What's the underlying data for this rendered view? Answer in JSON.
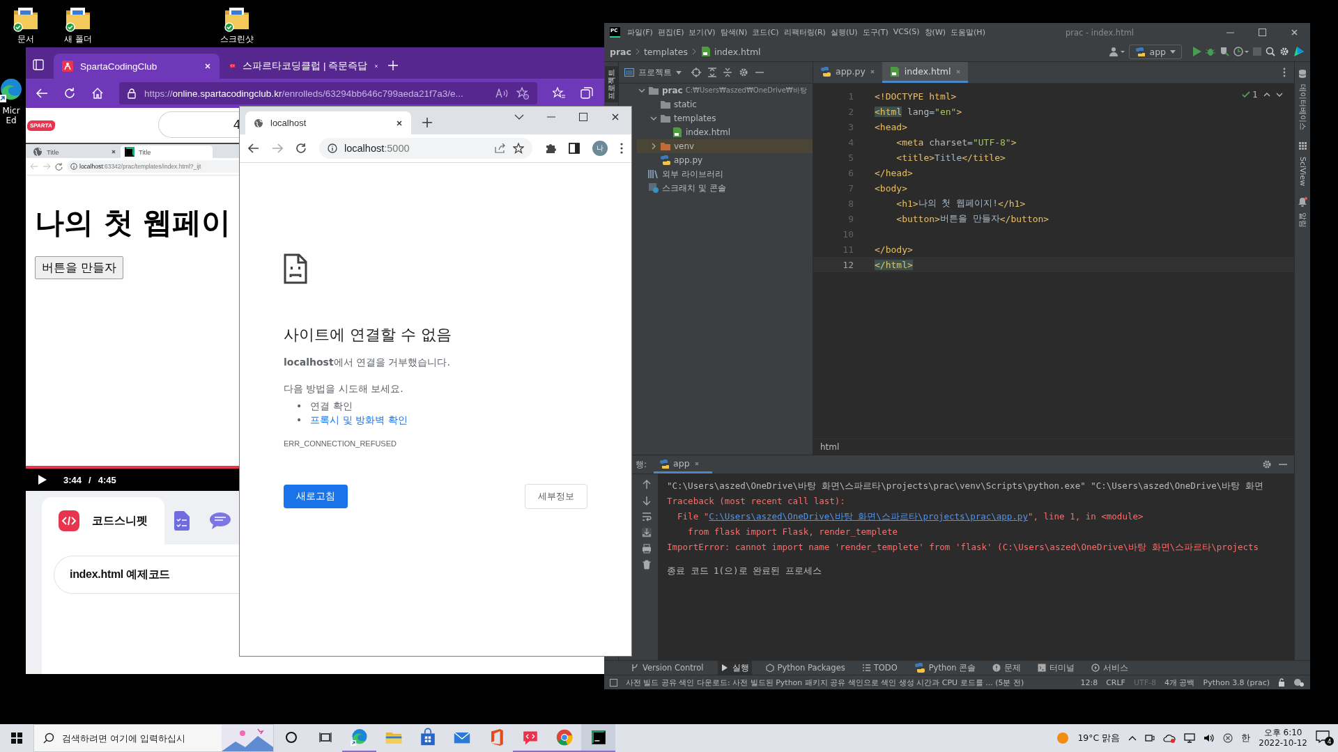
{
  "desktop_icons": [
    {
      "kind": "folder",
      "label": "문서"
    },
    {
      "kind": "folder",
      "label": "새 폴더"
    },
    {
      "kind": "folder",
      "label": "스크린샷"
    },
    {
      "kind": "edge",
      "label": "Micr Ed"
    }
  ],
  "edge": {
    "tabs": [
      {
        "kind": "sparta",
        "title": "SpartaCodingClub",
        "selected": true
      },
      {
        "kind": "qna",
        "title": "스파르타코딩클럽 | 즉문즉답",
        "selected": false
      }
    ],
    "url_scheme": "https://",
    "url_host": "online.spartacodingclub.kr",
    "url_path": "/enrolleds/63294bb646c799aeda21f7a3/e...",
    "logo": "SPARTA",
    "search_pill": "4",
    "video": {
      "tabs": [
        {
          "kind": "globe",
          "title": "Title",
          "selected": false
        },
        {
          "kind": "pycharm",
          "title": "Title",
          "selected": true
        }
      ],
      "url_host": "localhost",
      "url_path": ":63342/prac/templates/index.html?_ijt",
      "heading": "나의 첫 웹페이",
      "button": "버튼을 만들자",
      "current_time": "3:44",
      "time_separator": "/",
      "duration": "4:45"
    },
    "panel_tabs": [
      {
        "kind": "snippet",
        "label": "코드스니펫",
        "selected": true
      },
      {
        "kind": "checklist",
        "selected": false
      },
      {
        "kind": "chat",
        "selected": false
      }
    ],
    "snippet": "index.html 예제코드"
  },
  "chrome": {
    "tab_title": "localhost",
    "url_host": "localhost",
    "url_port": ":5000",
    "avatar": "나",
    "error": {
      "title": "사이트에 연결할 수 없음",
      "message": "**localhost**에서 연결을 거부했습니다.",
      "suggest": "다음 방법을 시도해 보세요.",
      "items": [
        {
          "kind": "text",
          "marker": "•",
          "text": "연결 확인"
        },
        {
          "kind": "link",
          "marker": "•",
          "text": "프록시 및 방화벽 확인"
        }
      ],
      "code": "ERR_CONNECTION_REFUSED",
      "reload": "새로고침",
      "details": "세부정보"
    }
  },
  "pycharm": {
    "logo": "PC",
    "menu": [
      "파일(F)",
      "편집(E)",
      "보기(V)",
      "탐색(N)",
      "코드(C)",
      "리팩터링(R)",
      "실행(U)",
      "도구(T)",
      "VCS(S)",
      "창(W)",
      "도움말(H)"
    ],
    "title": "prac - index.html",
    "breadcrumb": [
      {
        "kind": "project",
        "text": "prac"
      },
      {
        "kind": "folder",
        "text": "templates"
      },
      {
        "kind": "html",
        "text": "index.html"
      }
    ],
    "run_config": "app",
    "left_tools": [
      {
        "label": "프로젝트",
        "selected": true
      }
    ],
    "project_title": "프로젝트",
    "tree": [
      {
        "kind": "project",
        "name": "prac",
        "path": "C:₩Users₩aszed₩OneDrive₩바탕",
        "expanded": true,
        "selected": false,
        "children": [
          {
            "kind": "folder",
            "name": "static",
            "selected": false
          },
          {
            "kind": "folder",
            "name": "templates",
            "expanded": true,
            "selected": false,
            "children": [
              {
                "kind": "html",
                "name": "index.html",
                "selected": false
              }
            ]
          },
          {
            "kind": "excluded",
            "name": "venv",
            "expanded": false,
            "selected": true
          },
          {
            "kind": "python",
            "name": "app.py",
            "selected": false
          }
        ]
      },
      {
        "kind": "library",
        "name": "외부 라이브러리",
        "selected": false
      },
      {
        "kind": "scratch",
        "name": "스크래치 및 콘솔",
        "selected": false
      }
    ],
    "editor_tabs": [
      {
        "kind": "python",
        "name": "app.py",
        "selected": false
      },
      {
        "kind": "html",
        "name": "index.html",
        "selected": true
      }
    ],
    "inspections": "1",
    "code": [
      {
        "number": "1",
        "current": false,
        "tokens": [
          {
            "kind": "tag",
            "text": "<!DOCTYPE html>"
          }
        ]
      },
      {
        "number": "2",
        "current": false,
        "tokens": [
          {
            "kind": "tag",
            "text": "<html",
            "matched": true
          },
          {
            "kind": "attr",
            "text": " lang"
          },
          {
            "kind": "text",
            "text": "="
          },
          {
            "kind": "string",
            "text": "\"en\""
          },
          {
            "kind": "tag",
            "text": ">"
          }
        ]
      },
      {
        "number": "3",
        "current": false,
        "tokens": [
          {
            "kind": "tag",
            "text": "<head>"
          }
        ]
      },
      {
        "number": "4",
        "current": false,
        "tokens": [
          {
            "kind": "tag",
            "text": "    <meta"
          },
          {
            "kind": "attr",
            "text": " charset"
          },
          {
            "kind": "text",
            "text": "="
          },
          {
            "kind": "string",
            "text": "\"UTF-8\""
          },
          {
            "kind": "tag",
            "text": ">"
          }
        ]
      },
      {
        "number": "5",
        "current": false,
        "tokens": [
          {
            "kind": "tag",
            "text": "    <title>"
          },
          {
            "kind": "text",
            "text": "Title"
          },
          {
            "kind": "tag",
            "text": "</title>"
          }
        ]
      },
      {
        "number": "6",
        "current": false,
        "tokens": [
          {
            "kind": "tag",
            "text": "</head>"
          }
        ]
      },
      {
        "number": "7",
        "current": false,
        "tokens": [
          {
            "kind": "tag",
            "text": "<body>"
          }
        ]
      },
      {
        "number": "8",
        "current": false,
        "tokens": [
          {
            "kind": "tag",
            "text": "    <h1>"
          },
          {
            "kind": "text",
            "text": "나의 첫 웹페이지!"
          },
          {
            "kind": "tag",
            "text": "</h1>"
          }
        ]
      },
      {
        "number": "9",
        "current": false,
        "tokens": [
          {
            "kind": "tag",
            "text": "    <button>"
          },
          {
            "kind": "text",
            "text": "버튼을 만들자"
          },
          {
            "kind": "tag",
            "text": "</button>"
          }
        ]
      },
      {
        "number": "10",
        "current": false
      },
      {
        "number": "11",
        "current": false,
        "tokens": [
          {
            "kind": "tag",
            "text": "</body>"
          }
        ]
      },
      {
        "number": "12",
        "current": true,
        "tokens": [
          {
            "kind": "tag",
            "text": "</html>",
            "matched": true
          }
        ]
      }
    ],
    "editor_breadcrumb": "html",
    "right_tools": [
      {
        "kind": "database",
        "label": "데이터베이스"
      },
      {
        "kind": "sciview",
        "label": "SciView"
      },
      {
        "kind": "notifications",
        "label": "알림"
      }
    ],
    "run": {
      "label": "행:",
      "tab": "app",
      "lines": [
        {
          "segments": [
            {
              "kind": "command",
              "text": "\"C:\\Users\\aszed\\OneDrive\\바탕 화면\\스파르타\\projects\\prac\\venv\\Scripts\\python.exe\" \"C:\\Users\\aszed\\OneDrive\\바탕 화면"
            }
          ]
        },
        {
          "segments": [
            {
              "kind": "error",
              "text": "Traceback (most recent call last):"
            }
          ]
        },
        {
          "segments": [
            {
              "kind": "error",
              "text": "  File \""
            },
            {
              "kind": "link",
              "text": "C:\\Users\\aszed\\OneDrive\\바탕 화면\\스파르타\\projects\\prac\\app.py"
            },
            {
              "kind": "error",
              "text": "\", line 1, in <module>"
            }
          ]
        },
        {
          "segments": [
            {
              "kind": "error",
              "text": "    from flask import Flask, render_templete"
            }
          ]
        },
        {
          "segments": [
            {
              "kind": "error",
              "text": "ImportError: cannot import name 'render_templete' from 'flask' (C:\\Users\\aszed\\OneDrive\\바탕 화면\\스파르타\\projects"
            }
          ]
        },
        {
          "segments": [
            {
              "kind": "exit",
              "text": "종료 코드 1(으)로 완료된 프로세스"
            }
          ]
        }
      ]
    },
    "tool_tabs": [
      {
        "kind": "vcs",
        "label": "Version Control",
        "selected": false
      },
      {
        "kind": "run",
        "label": "실행",
        "selected": true
      },
      {
        "kind": "packages",
        "label": "Python Packages",
        "selected": false
      },
      {
        "kind": "todo",
        "label": "TODO",
        "selected": false
      },
      {
        "kind": "console",
        "label": "Python 콘솔",
        "selected": false
      },
      {
        "kind": "problems",
        "label": "문제",
        "selected": false
      },
      {
        "kind": "terminal",
        "label": "터미널",
        "selected": false
      },
      {
        "kind": "services",
        "label": "서비스",
        "selected": false
      }
    ],
    "status": {
      "message": "사전 빌드 공유 색인 다운로드: 사전 빌드된 Python 패키지 공유 색인으로 색인 생성 시간과 CPU 로드를 ... (5분 전)",
      "items": [
        {
          "text": "12:8",
          "disabled": false
        },
        {
          "text": "CRLF",
          "disabled": false
        },
        {
          "text": "UTF-8",
          "disabled": true
        },
        {
          "text": "4개 공백",
          "disabled": false
        },
        {
          "text": "Python 3.8 (prac)",
          "disabled": false
        }
      ]
    }
  },
  "taskbar": {
    "search_placeholder": "검색하려면 여기에 입력하십시",
    "apps": [
      {
        "kind": "edge",
        "open": true,
        "selected": false
      },
      {
        "kind": "explorer",
        "open": false,
        "selected": false
      },
      {
        "kind": "store",
        "open": false,
        "selected": false
      },
      {
        "kind": "mail",
        "open": false,
        "selected": false
      },
      {
        "kind": "office",
        "open": false,
        "selected": false
      },
      {
        "kind": "sparta",
        "open": true,
        "selected": false
      },
      {
        "kind": "chrome",
        "open": true,
        "selected": false
      },
      {
        "kind": "pycharm",
        "open": true,
        "selected": true
      }
    ],
    "weather": "19°C 맑음",
    "ime": "한",
    "time": "오후 6:10",
    "date": "2022-10-12",
    "notifications": "4"
  }
}
